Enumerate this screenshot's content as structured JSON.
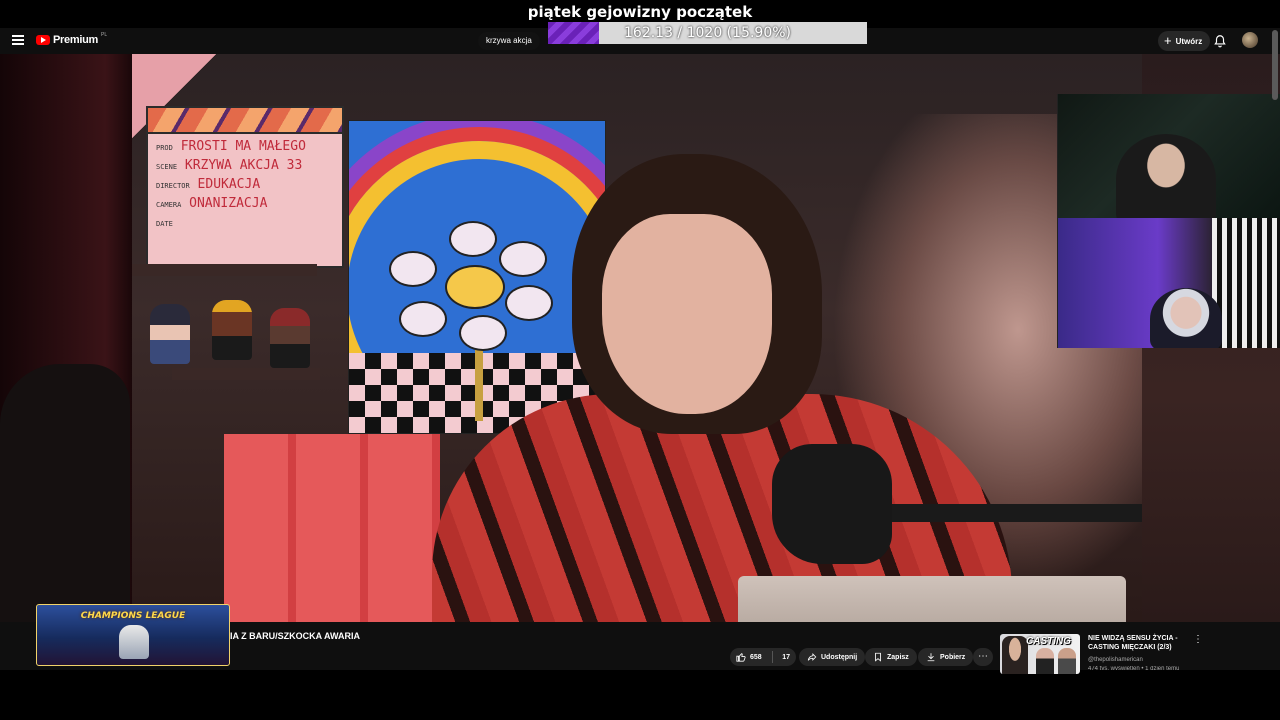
{
  "overlay": {
    "title": "piątek gejowizny początek",
    "goal_text": "162.13 / 1020 (15.90%)",
    "goal_progress": 0.159
  },
  "topbar": {
    "logo_label": "Premium",
    "logo_region": "PL",
    "search_text": "krzywa akcja",
    "create_label": "Utwórz",
    "icons": [
      "menu-icon",
      "youtube-logo-icon",
      "plus-icon",
      "bell-icon"
    ]
  },
  "scene": {
    "clapper_lines": [
      "FROSTI MA MAŁEGO",
      "KRZYWA AKCJA",
      "33",
      "EDUKACJA",
      "ONANIZACJA"
    ],
    "clapper_labels": [
      "PROD",
      "SCENE",
      "DIRECTOR",
      "CAMERA",
      "DATE"
    ]
  },
  "bottom": {
    "thumb_text": "CHAMPIONS LEAGUE",
    "video_title": "IA Z BARU/SZKOCKA AWARIA",
    "like_count": "658",
    "dislike_count": "17",
    "share_label": "Udostępnij",
    "save_label": "Zapisz",
    "download_label": "Pobierz",
    "icons": [
      "thumbs-up-icon",
      "share-icon",
      "bookmark-icon",
      "download-icon",
      "more-horizontal-icon"
    ]
  },
  "recommended": {
    "thumb_text": "CASTING",
    "title": "NIE WIDZĄ SENSU ŻYCIA - CASTING MIĘCZAKI (2/3)",
    "channel": "@thepolishamerican",
    "meta": "474 tys. wyświetleń • 1 dzień temu"
  },
  "colors": {
    "youtube_red": "#ff0000",
    "goal_fill": "#7a2fcc",
    "bar_bg": "#0f0f0f",
    "pill_bg": "#272727"
  }
}
